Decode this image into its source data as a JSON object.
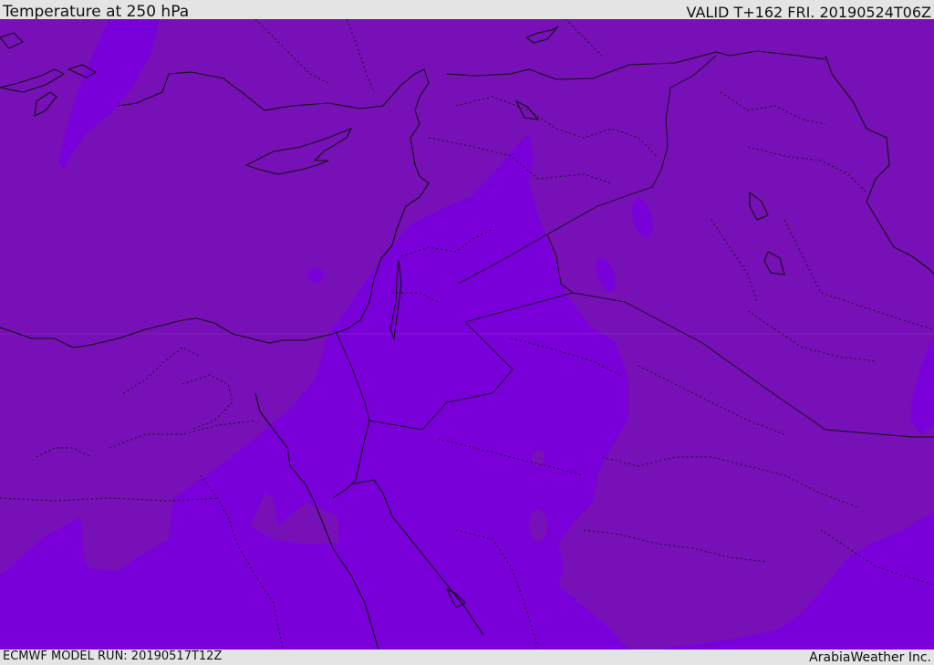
{
  "header": {
    "title": "Temperature at 250 hPa",
    "valid_time": "VALID T+162 FRI. 20190524T06Z"
  },
  "footer": {
    "model_run": "ECMWF MODEL RUN: 20190517T12Z",
    "brand": "ArabiaWeather Inc."
  },
  "colors": {
    "warmer_band": "#7710b6",
    "colder_band": "#7a00da",
    "coastline": "#111111",
    "borders": "#111111",
    "bar_background": "#e4e4e4"
  }
}
